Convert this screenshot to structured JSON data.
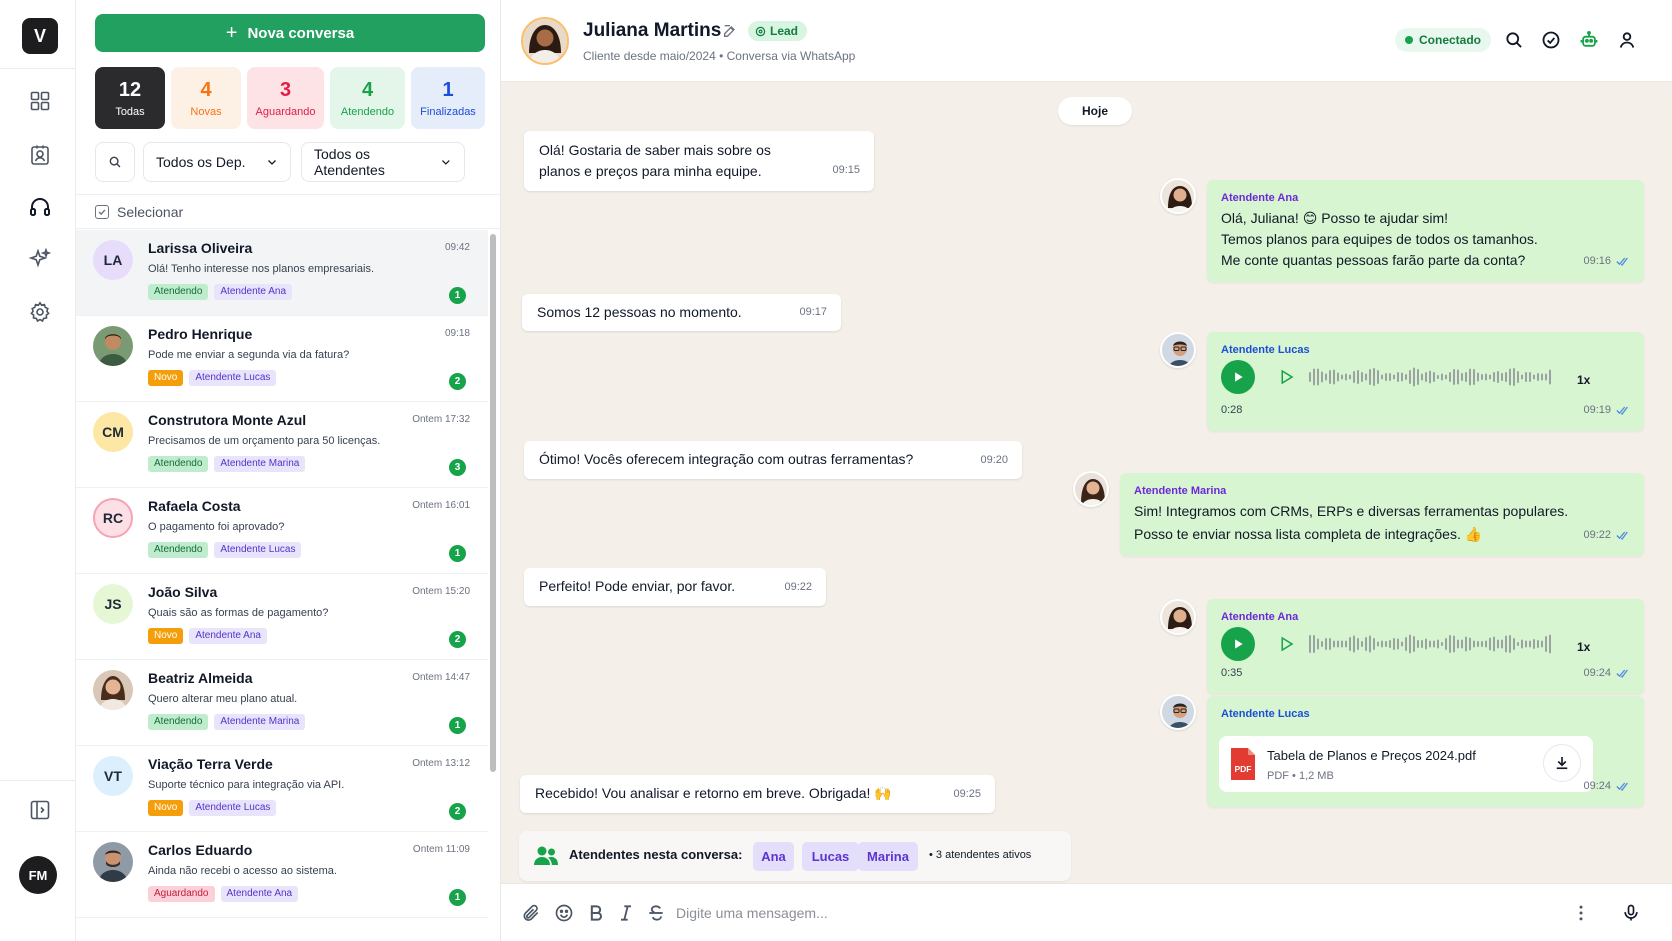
{
  "rail": {
    "logo": "V",
    "user_initials": "FM",
    "nav_icons": [
      "grid-icon",
      "contacts-icon",
      "headset-icon",
      "sparkles-icon",
      "settings-icon"
    ],
    "bottom_icon": "collapse-panel-icon"
  },
  "list": {
    "new_button": "Nova conversa",
    "stats": [
      {
        "count": "12",
        "label": "Todas",
        "color": "#2b2b2e"
      },
      {
        "count": "4",
        "label": "Novas",
        "color": "#f97316"
      },
      {
        "count": "3",
        "label": "Aguardando",
        "color": "#e11d48"
      },
      {
        "count": "4",
        "label": "Atendendo",
        "color": "#16a34a"
      },
      {
        "count": "1",
        "label": "Finalizadas",
        "color": "#1d4ed8"
      }
    ],
    "filter_dept": "Todos os Dep.",
    "filter_agents": "Todos os Atendentes",
    "select_label": "Selecionar",
    "conversations": [
      {
        "initials": "LA",
        "name": "Larissa Oliveira",
        "time": "09:42",
        "preview": "Olá! Tenho interesse nos planos empresariais.",
        "status": "Atendendo",
        "agent": "Atendente Ana",
        "unread": "1"
      },
      {
        "initials": "",
        "name": "Pedro Henrique",
        "time": "09:18",
        "preview": "Pode me enviar a segunda via da fatura?",
        "status": "Novo",
        "agent": "Atendente Lucas",
        "unread": "2"
      },
      {
        "initials": "CM",
        "name": "Construtora Monte Azul",
        "time": "Ontem 17:32",
        "preview": "Precisamos de um orçamento para 50 licenças.",
        "status": "Atendendo",
        "agent": "Atendente Marina",
        "unread": "3"
      },
      {
        "initials": "RC",
        "name": "Rafaela Costa",
        "time": "Ontem 16:01",
        "preview": "O pagamento foi aprovado?",
        "status": "Atendendo",
        "agent": "Atendente Lucas",
        "unread": "1"
      },
      {
        "initials": "JS",
        "name": "João Silva",
        "time": "Ontem 15:20",
        "preview": "Quais são as formas de pagamento?",
        "status": "Novo",
        "agent": "Atendente Ana",
        "unread": "2"
      },
      {
        "initials": "",
        "name": "Beatriz Almeida",
        "time": "Ontem 14:47",
        "preview": "Quero alterar meu plano atual.",
        "status": "Atendendo",
        "agent": "Atendente Marina",
        "unread": "1"
      },
      {
        "initials": "VT",
        "name": "Viação Terra Verde",
        "time": "Ontem 13:12",
        "preview": "Suporte técnico para integração via API.",
        "status": "Novo",
        "agent": "Atendente Lucas",
        "unread": "2"
      },
      {
        "initials": "",
        "name": "Carlos Eduardo",
        "time": "Ontem 11:09",
        "preview": "Ainda não recebi o acesso ao sistema.",
        "status": "Aguardando",
        "agent": "Atendente Ana",
        "unread": "1"
      }
    ]
  },
  "chat": {
    "contact_name": "Juliana Martins",
    "contact_tag": "Lead",
    "contact_sub": "Cliente desde maio/2024 • Conversa via WhatsApp",
    "connection": "Conectado",
    "day": "Hoje",
    "msgs": {
      "in1": {
        "text1": "Olá! Gostaria de saber mais sobre os",
        "text2": "planos e preços para minha equipe.",
        "time": "09:15"
      },
      "out1": {
        "who": "Atendente Ana",
        "line1": "Olá, Juliana! 😊 Posso te ajudar sim!",
        "line2": "Temos planos para equipes de todos os tamanhos.",
        "line3": "Me conte quantas pessoas farão parte da conta?",
        "time": "09:16"
      },
      "in2": {
        "text": "Somos 12 pessoas no momento.",
        "time": "09:17"
      },
      "out2": {
        "who": "Atendente Lucas",
        "duration": "0:28",
        "speed": "1x",
        "time": "09:19"
      },
      "in3": {
        "text": "Ótimo! Vocês oferecem integração com outras ferramentas?",
        "time": "09:20"
      },
      "out3": {
        "who": "Atendente Marina",
        "line1": "Sim! Integramos com CRMs, ERPs e diversas ferramentas populares.",
        "line2": "Posso te enviar nossa lista completa de integrações. 👍",
        "time": "09:22"
      },
      "in4": {
        "text": "Perfeito! Pode enviar, por favor.",
        "time": "09:22"
      },
      "out4": {
        "who": "Atendente Ana",
        "duration": "0:35",
        "speed": "1x",
        "time": "09:24"
      },
      "out5": {
        "who": "Atendente Lucas",
        "file_name": "Tabela de Planos e Preços 2024.pdf",
        "file_meta": "PDF • 1,2 MB",
        "file_badge": "PDF",
        "time": "09:24"
      },
      "in5": {
        "text": "Recebido! Vou analisar e retorno em breve. Obrigada! 🙌",
        "time": "09:25"
      }
    },
    "agents_bar": {
      "label": "Atendentes nesta conversa:",
      "agents": [
        "Ana",
        "Lucas",
        "Marina"
      ],
      "count": "• 3 atendentes ativos"
    },
    "composer_placeholder": "Digite uma mensagem..."
  },
  "colors": {
    "brand_green": "#21a060",
    "out_bubble": "#d7f5d0",
    "chat_bg": "#f4efe9",
    "tick_blue": "#4f8be0"
  }
}
